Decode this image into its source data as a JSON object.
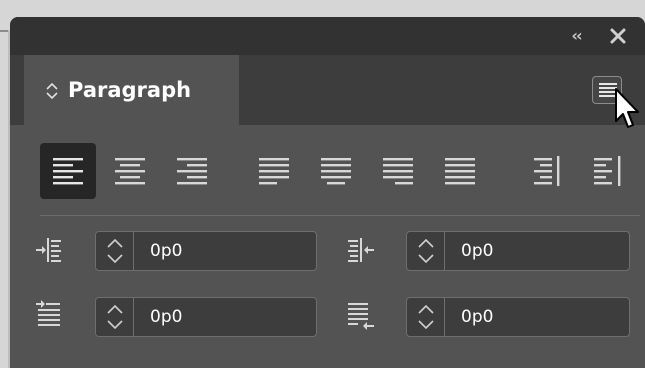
{
  "panel": {
    "title": "Paragraph",
    "titlebar": {
      "collapse_icon": "double-chevron-left-icon",
      "close_icon": "close-icon"
    },
    "menu_icon": "panel-menu-icon",
    "alignment_buttons": [
      {
        "name": "align-left",
        "icon": "align-left-icon",
        "active": true
      },
      {
        "name": "align-center",
        "icon": "align-center-icon",
        "active": false
      },
      {
        "name": "align-right",
        "icon": "align-right-icon",
        "active": false
      },
      {
        "name": "justify-left",
        "icon": "justify-with-last-line-left-icon",
        "active": false
      },
      {
        "name": "justify-center",
        "icon": "justify-with-last-line-centered-icon",
        "active": false
      },
      {
        "name": "justify-right",
        "icon": "justify-with-last-line-right-icon",
        "active": false
      },
      {
        "name": "justify-all",
        "icon": "justify-all-lines-icon",
        "active": false
      },
      {
        "name": "align-towards-spine",
        "icon": "align-towards-spine-icon",
        "active": false
      },
      {
        "name": "align-away-from-spine",
        "icon": "align-away-from-spine-icon",
        "active": false
      }
    ],
    "indents": {
      "left_indent": {
        "value": "0p0",
        "icon": "left-indent-icon"
      },
      "right_indent": {
        "value": "0p0",
        "icon": "right-indent-icon"
      },
      "first_line_indent": {
        "value": "0p0",
        "icon": "first-line-left-indent-icon"
      },
      "last_line_indent": {
        "value": "0p0",
        "icon": "last-line-right-indent-icon"
      }
    }
  },
  "colors": {
    "panel_bg": "#535353",
    "titlebar_bg": "#323232",
    "field_bg": "#3d3d3d",
    "active_button_bg": "#262626",
    "text": "#ffffff"
  }
}
